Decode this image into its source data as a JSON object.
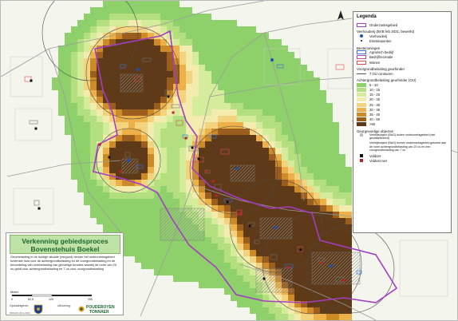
{
  "legend": {
    "title": "Legenda",
    "onderzoeksgebied": "Onderzoeksgebied",
    "veehouderij_header": "Veehouderij (BVB feb 2021, bewerkt)",
    "veehouderij": "Veehouderij",
    "emissiepunten": "Emissiepunten",
    "bestemmingen_header": "Bestemmingen",
    "agrarisch": "Agrarisch bedrijf",
    "bedrijf_recreatie": "Bedrijf/recreatie",
    "wonen": "Wonen",
    "voorgrond_header": "Voorgrondbelasting geurhinder",
    "contour": "7 OU contouren",
    "achtergrond_header": "Achtergrondbelasting geurhinder (OU)",
    "classes": [
      {
        "label": "5 - 10",
        "color": "#8ed06a"
      },
      {
        "label": "10 - 15",
        "color": "#b3df7f"
      },
      {
        "label": "15 - 20",
        "color": "#d4ec9b"
      },
      {
        "label": "20 - 25",
        "color": "#f3ecae"
      },
      {
        "label": "25 - 30",
        "color": "#f4d37f"
      },
      {
        "label": "30 - 35",
        "color": "#eeb14a"
      },
      {
        "label": "35 - 40",
        "color": "#cf8a28"
      },
      {
        "label": "40 - 50",
        "color": "#9b5e1e"
      },
      {
        "label": ">50",
        "color": "#5e3a18"
      }
    ],
    "gevoelige_header": "Geurgevoelige objecten",
    "gevoelige_note1": "Verblijfsobject (BAG) buiten onderzoeksgebied (niet geclassificeerd)",
    "gevoelige_note2": "Verblijfsobject (BAG) binnen onderzoeksgebied getoetst aan de norm achtergrondbelasting van 20 ou en een voorgrondbelasting van 7 ou",
    "voldoet": "Voldoet",
    "voldoet_niet": "Voldoet niet"
  },
  "titlebox": {
    "title_line1": "Verkenning gebiedsproces",
    "title_line2": "Bovenstehuis Boekel",
    "description": "Geurbelasting in de huidige situatie (vergund) binnen het onderzoeksgebied bovenste huis voor de achtergrondbelasting en de voorgrondbelasting en de beoordeling van overbelasting van gevoelige functies waarbij de norm van 20 ou geldt voor achtergrondbelasting en 7 ou voor voorgrondbelasting",
    "scale_label": "Meter",
    "scale_ticks": [
      "0",
      "62,5",
      "125",
      "250"
    ],
    "opdrachtgever": "Opdrachtgever:",
    "uitvoering": "Uitvoering:",
    "company_line1": "POUDEROYEN",
    "company_line2": "TONNAER",
    "footer_code": "R000101.4R.G-0001"
  },
  "colors": {
    "study_area": "#a43cc4",
    "background": "#f4f6ee",
    "agrarisch": "#3a6ee0",
    "bedrijf": "#b04ab0",
    "wonen": "#d84d4d",
    "title_green": "#1e6630"
  }
}
